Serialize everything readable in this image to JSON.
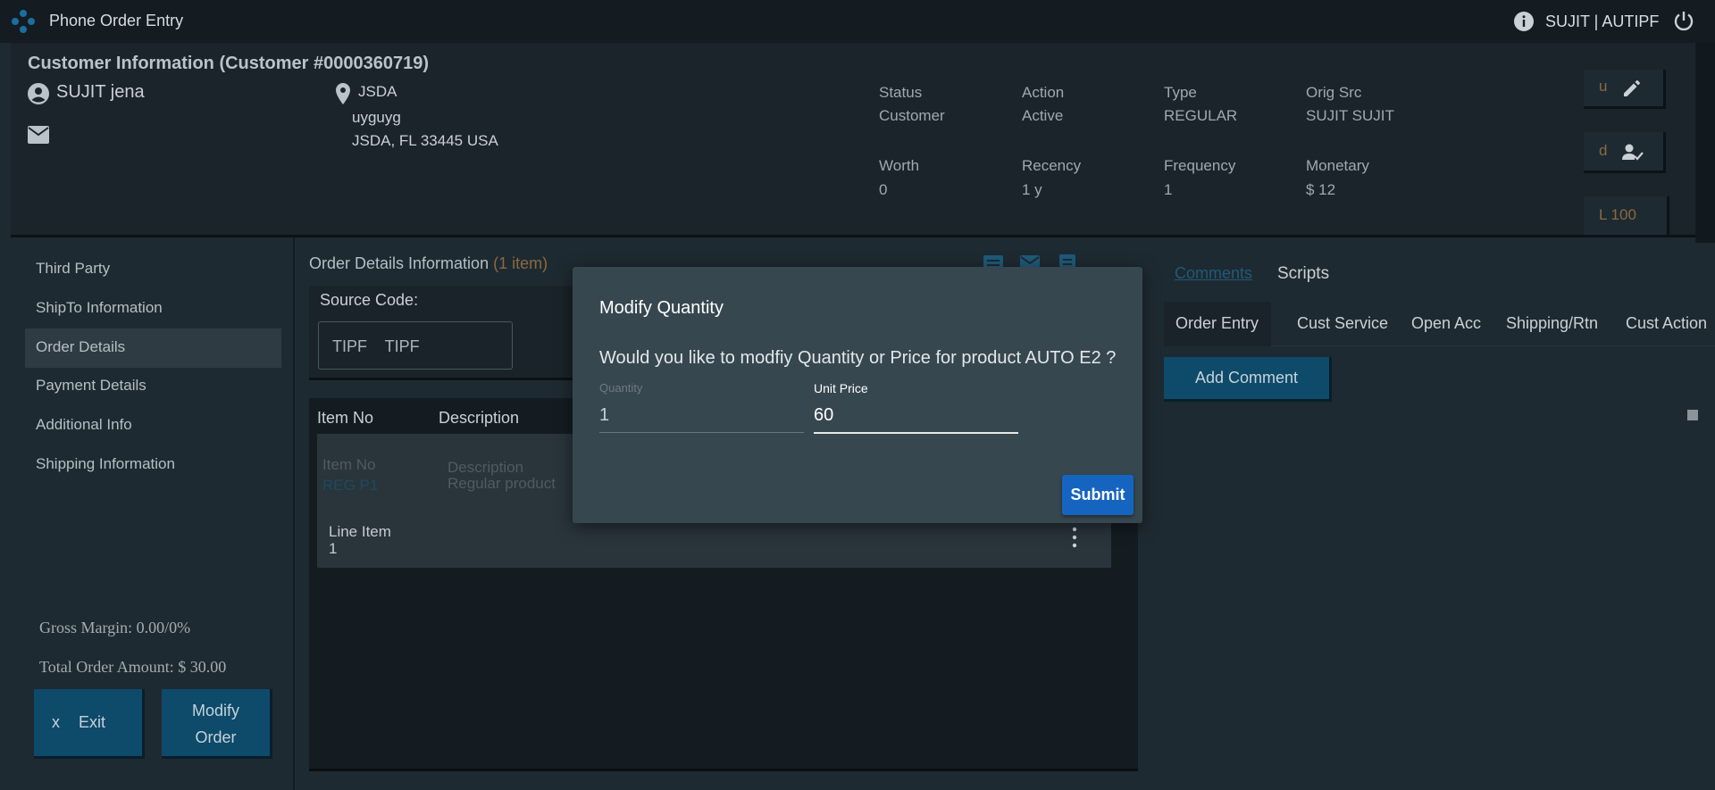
{
  "app": {
    "title": "Phone Order Entry",
    "user": "SUJIT | AUTIPF"
  },
  "customer": {
    "title": "Customer Information (Customer #0000360719)",
    "name": "SUJIT jena",
    "address": {
      "name": "JSDA",
      "line1": "uyguyg",
      "line2": "JSDA, FL 33445 USA"
    },
    "stats": [
      {
        "label": "Status",
        "value": "Customer"
      },
      {
        "label": "Action",
        "value": "Active"
      },
      {
        "label": "Type",
        "value": "REGULAR"
      },
      {
        "label": "Orig Src",
        "value": "SUJIT SUJIT"
      },
      {
        "label": "Worth",
        "value": "0"
      },
      {
        "label": "Recency",
        "value": "1 y"
      },
      {
        "label": "Frequency",
        "value": "1"
      },
      {
        "label": "Monetary",
        "value": "$ 12"
      }
    ],
    "side_buttons": {
      "u": "u",
      "d": "d",
      "l": "L 100"
    }
  },
  "nav": {
    "items": [
      "Third Party",
      "ShipTo Information",
      "Order Details",
      "Payment Details",
      "Additional Info",
      "Shipping Information"
    ],
    "active": "Order Details"
  },
  "totals": {
    "gross_margin": "Gross Margin: 0.00/0%",
    "total_amount": "Total Order Amount: $ 30.00"
  },
  "actions": {
    "exit_x": "x",
    "exit": "Exit",
    "modify_line1": "Modify",
    "modify_line2": "Order"
  },
  "order": {
    "title": "Order Details Information",
    "count": "(1 item)",
    "source_label": "Source Code:",
    "source_value": "TIPF    TIPF",
    "columns": [
      "Item No",
      "Description"
    ],
    "row": {
      "item_no_label": "Item No",
      "item_no": "REG P1",
      "description_label": "Description",
      "description": "Regular product",
      "line_item_label": "Line Item",
      "line_item": "1"
    }
  },
  "right": {
    "tabs": [
      "Comments",
      "Scripts"
    ],
    "subtabs": [
      "Order Entry",
      "Cust Service",
      "Open Acc",
      "Shipping/Rtn",
      "Cust Action"
    ],
    "add_comment": "Add Comment"
  },
  "modal": {
    "title": "Modify Quantity",
    "question": "Would you like to modfiy Quantity or Price for product AUTO E2 ?",
    "quantity_label": "Quantity",
    "quantity": "1",
    "price_label": "Unit Price",
    "price": "60",
    "submit": "Submit"
  },
  "colors": {
    "accent": "#1565c0",
    "button": "#0e4a6a",
    "background": "#1e2a31"
  },
  "icons": [
    "app-logo-icon",
    "info-icon",
    "power-icon",
    "person-icon",
    "mail-icon",
    "location-pin-icon",
    "edit-icon",
    "person-check-icon",
    "list-icon",
    "email-icon",
    "document-icon",
    "more-vert-icon"
  ]
}
